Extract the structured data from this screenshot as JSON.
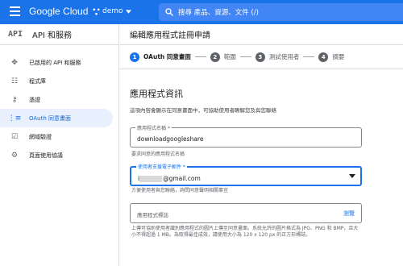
{
  "topbar": {
    "brand": "Google Cloud",
    "project": "demo",
    "search_placeholder": "搜尋 產品、資源、文件 (/)"
  },
  "sidebar": {
    "logo": "API",
    "title": "API 和服務",
    "items": [
      {
        "label": "已啟用的 API 和服務",
        "icon": "diamond-nodes-icon"
      },
      {
        "label": "程式庫",
        "icon": "library-grid-icon"
      },
      {
        "label": "憑證",
        "icon": "key-icon"
      },
      {
        "label": "OAuth 同意畫面",
        "icon": "consent-list-icon",
        "active": true
      },
      {
        "label": "網域驗證",
        "icon": "checkbox-icon"
      },
      {
        "label": "頁面使用協議",
        "icon": "settings-list-icon"
      }
    ]
  },
  "main": {
    "page_title": "編輯應用程式註冊申請",
    "steps": [
      {
        "num": "1",
        "label": "OAuth 同意畫面"
      },
      {
        "num": "2",
        "label": "範圍"
      },
      {
        "num": "3",
        "label": "測試使用者"
      },
      {
        "num": "4",
        "label": "摘要"
      }
    ],
    "section_title": "應用程式資訊",
    "section_desc": "這項內容會顯示在同意畫面中，可協助使用者瞭解您及與您聯絡",
    "app_name_label": "應用程式名稱 *",
    "app_name_value": "downloadgoogleshare",
    "app_name_hint": "要求同意的應用程式名稱",
    "email_label": "使用者支援電子郵件 *",
    "email_prefix": "i",
    "email_value": "@gmail.com",
    "email_hint": "方便使用者與您聯絡，詢問同意聲明相關事宜",
    "logo_placeholder": "應用程式標誌",
    "logo_browse": "瀏覽",
    "logo_hint": "上傳可協助使用者識別應用程式的圖片上傳至同意畫面。系統允許的圖片格式為 JPG、PNG 和 BMP，且大小不得超過 1 MB。為取得最佳成效，請使用大小為 120 x 120 px 的正方形標誌。"
  }
}
